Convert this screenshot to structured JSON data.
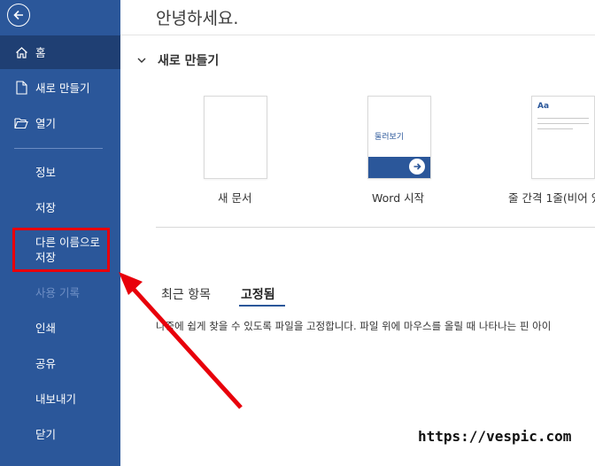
{
  "sidebar": {
    "items": [
      {
        "label": "홈",
        "icon": "home-icon"
      },
      {
        "label": "새로 만들기",
        "icon": "new-document-icon"
      },
      {
        "label": "열기",
        "icon": "folder-open-icon"
      },
      {
        "label": "정보"
      },
      {
        "label": "저장"
      },
      {
        "label": "다른 이름으로 저장"
      },
      {
        "label": "사용 기록"
      },
      {
        "label": "인쇄"
      },
      {
        "label": "공유"
      },
      {
        "label": "내보내기"
      },
      {
        "label": "닫기"
      }
    ],
    "save_as_line1": "다른 이름으로",
    "save_as_line2": "저장"
  },
  "main": {
    "greeting": "안녕하세요.",
    "new_section_title": "새로 만들기",
    "templates": [
      {
        "label": "새 문서"
      },
      {
        "label": "Word 시작",
        "thumb_text": "둘러보기"
      },
      {
        "label": "줄 간격 1줄(비어 있",
        "thumb_text": "Aa"
      }
    ],
    "tabs": [
      {
        "label": "최근 항목"
      },
      {
        "label": "고정됨",
        "active": true
      }
    ],
    "pinned_description": "나중에 쉽게 찾을 수 있도록 파일을 고정합니다. 파일 위에 마우스를 올릴 때 나타나는 핀 아이"
  },
  "watermark": "https://vespic.com",
  "colors": {
    "sidebar_bg": "#2b579a",
    "sidebar_active": "#1f3f73",
    "highlight": "#e8000b",
    "accent": "#2b579a"
  }
}
